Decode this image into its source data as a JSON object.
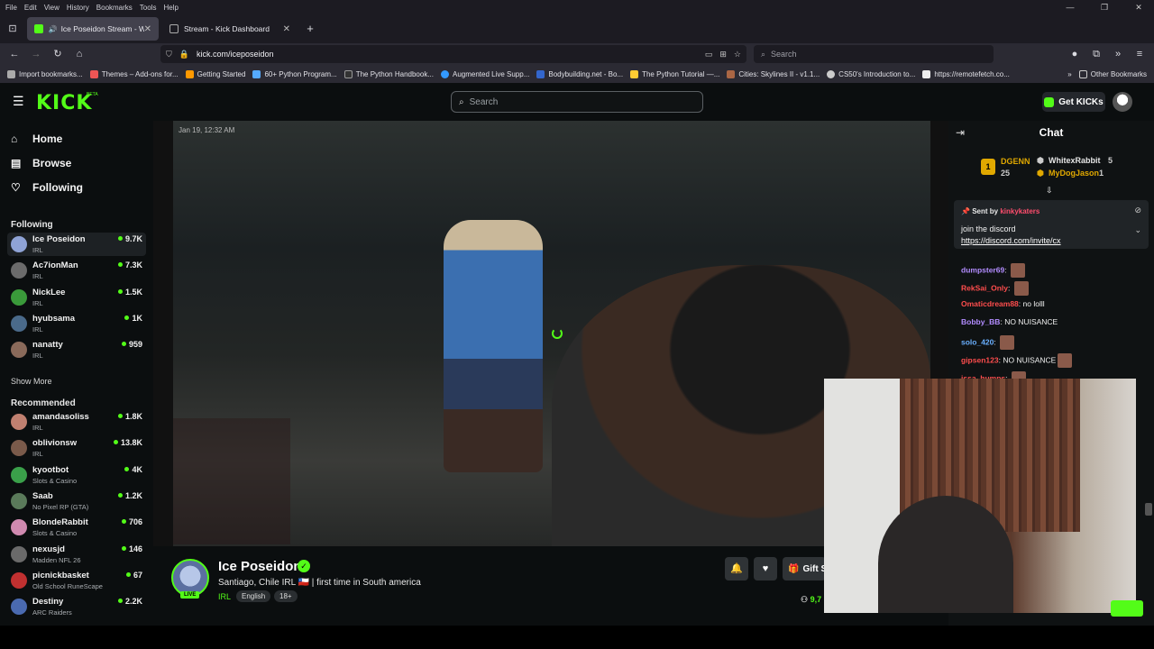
{
  "browser": {
    "menu": [
      "File",
      "Edit",
      "View",
      "History",
      "Bookmarks",
      "Tools",
      "Help"
    ],
    "tabs": [
      {
        "title": "Ice Poseidon Stream - Watc"
      },
      {
        "title": "Stream - Kick Dashboard"
      }
    ],
    "url": "kick.com/iceposeidon",
    "search_placeholder": "Search",
    "bookmarks": [
      "Import bookmarks...",
      "Themes – Add-ons for...",
      "Getting Started",
      "60+ Python Program...",
      "The Python Handbook...",
      "Augmented Live Supp...",
      "Bodybuilding.net - Bo...",
      "The Python Tutorial —...",
      "Cities: Skylines II - v1.1...",
      "CS50's Introduction to...",
      "https://remotefetch.co..."
    ],
    "other_bookmarks": "Other Bookmarks"
  },
  "header": {
    "logo": "KICK",
    "beta": "BETA",
    "search_placeholder": "Search",
    "get_kicks": "Get KICKs"
  },
  "sidebar": {
    "nav": [
      {
        "label": "Home",
        "icon": "home-icon"
      },
      {
        "label": "Browse",
        "icon": "browse-icon"
      },
      {
        "label": "Following",
        "icon": "heart-icon"
      }
    ],
    "following_title": "Following",
    "following": [
      {
        "name": "Ice Poseidon",
        "category": "IRL",
        "viewers": "9.7K",
        "color": "#8fa3d6"
      },
      {
        "name": "Ac7ionMan",
        "category": "IRL",
        "viewers": "7.3K",
        "color": "#6b6b6b"
      },
      {
        "name": "NickLee",
        "category": "IRL",
        "viewers": "1.5K",
        "color": "#3a9a3a"
      },
      {
        "name": "hyubsama",
        "category": "IRL",
        "viewers": "1K",
        "color": "#4a6a8a"
      },
      {
        "name": "nanatty",
        "category": "IRL",
        "viewers": "959",
        "color": "#8a6a5a"
      }
    ],
    "show_more": "Show More",
    "recommended_title": "Recommended",
    "recommended": [
      {
        "name": "amandasoliss",
        "category": "IRL",
        "viewers": "1.8K",
        "color": "#c08070"
      },
      {
        "name": "oblivionsw",
        "category": "IRL",
        "viewers": "13.8K",
        "color": "#7a5a4a"
      },
      {
        "name": "kyootbot",
        "category": "Slots & Casino",
        "viewers": "4K",
        "color": "#3aa04a"
      },
      {
        "name": "Saab",
        "category": "No Pixel RP (GTA)",
        "viewers": "1.2K",
        "color": "#5a7a5a"
      },
      {
        "name": "BlondeRabbit",
        "category": "Slots & Casino",
        "viewers": "706",
        "color": "#d08ab0"
      },
      {
        "name": "nexusjd",
        "category": "Madden NFL 26",
        "viewers": "146",
        "color": "#6a6a6a"
      },
      {
        "name": "picnickbasket",
        "category": "Old School RuneScape",
        "viewers": "67",
        "color": "#c03030"
      },
      {
        "name": "Destiny",
        "category": "ARC Raiders",
        "viewers": "2.2K",
        "color": "#4a6ab0"
      }
    ]
  },
  "video": {
    "timestamp": "Jan 19, 12:32 AM"
  },
  "stream": {
    "name": "Ice Poseidon",
    "live": "LIVE",
    "title": "Santiago, Chile IRL 🇨🇱 | first time in South america",
    "category": "IRL",
    "tags": [
      "English",
      "18+"
    ],
    "gift_label": "Gift S",
    "viewers": "9,7"
  },
  "chat": {
    "title": "Chat",
    "gifters": [
      {
        "rank": "1",
        "name": "DGENN",
        "count": "25"
      },
      {
        "name": "WhitexRabbit",
        "count": "5"
      },
      {
        "name": "MyDogJason",
        "count": "1"
      }
    ],
    "pinned": {
      "sent_by": "Sent by",
      "user": "kinkykaters",
      "message": "join the discord",
      "link": "https://discord.com/invite/cx"
    },
    "messages": [
      {
        "user": "dumpster69",
        "text": "",
        "color": "#b28cff",
        "emote": true
      },
      {
        "user": "RekSai_Only",
        "text": "",
        "color": "#ff4d4d",
        "emote": true
      },
      {
        "user": "Omaticdream88",
        "text": "no lolll",
        "color": "#ff4d4d",
        "emote": false
      },
      {
        "user": "Bobby_BB",
        "text": "NO NUISANCE",
        "color": "#b28cff",
        "emote": false
      },
      {
        "user": "solo_420",
        "text": "",
        "color": "#6ab0ff",
        "emote": true
      },
      {
        "user": "gipsen123",
        "text": "NO NUISANCE",
        "color": "#ff4d4d",
        "emote": true
      },
      {
        "user": "issa_humps",
        "text": "",
        "color": "#ff4d4d",
        "emote": true
      }
    ]
  }
}
